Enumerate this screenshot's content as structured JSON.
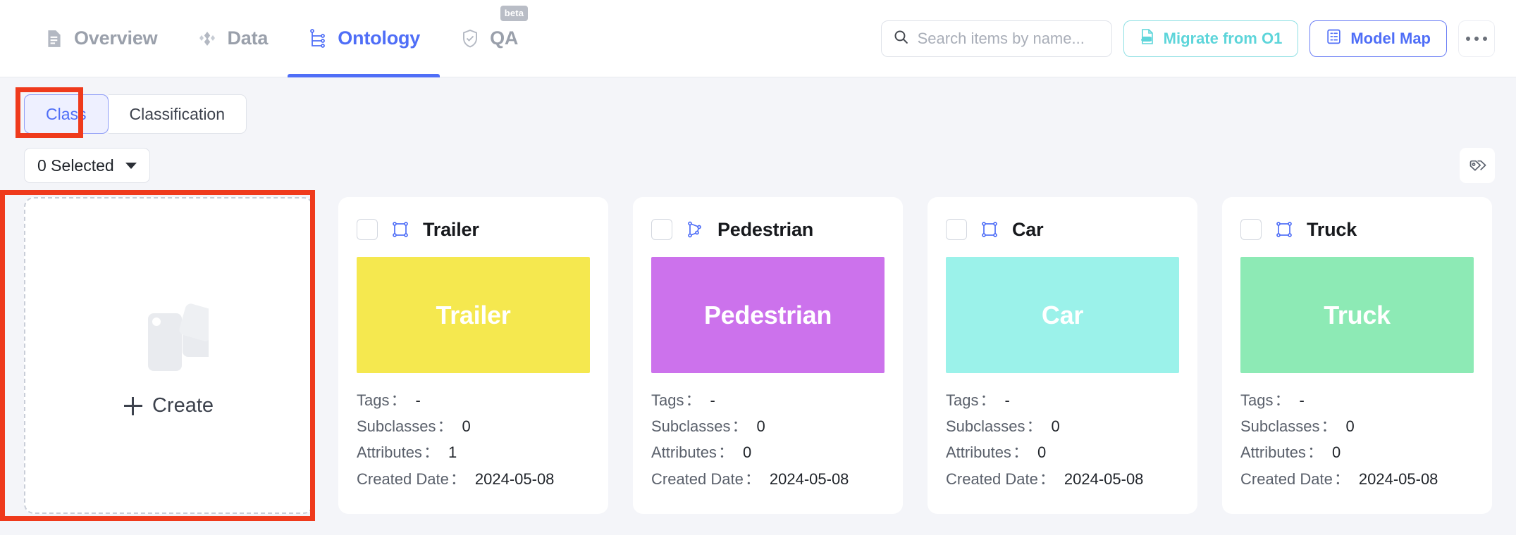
{
  "header": {
    "nav": [
      {
        "label": "Overview",
        "icon": "document-icon",
        "active": false,
        "badge": null
      },
      {
        "label": "Data",
        "icon": "diamond-icon",
        "active": false,
        "badge": null
      },
      {
        "label": "Ontology",
        "icon": "hierarchy-icon",
        "active": true,
        "badge": null
      },
      {
        "label": "QA",
        "icon": "shield-check-icon",
        "active": false,
        "badge": "beta"
      }
    ],
    "search": {
      "placeholder": "Search items by name...",
      "value": "",
      "icon": "search-icon"
    },
    "migrate_button": {
      "label": "Migrate from O1",
      "icon": "json-file-icon"
    },
    "model_map_button": {
      "label": "Model Map",
      "icon": "list-panel-icon"
    },
    "more_button": {
      "label": "",
      "icon": "more-horizontal-icon"
    }
  },
  "toolbar": {
    "segments": [
      {
        "label": "Class",
        "active": true
      },
      {
        "label": "Classification",
        "active": false
      }
    ],
    "selected_dropdown": {
      "label": "0 Selected",
      "icon": "chevron-down-icon"
    },
    "tag_button": {
      "icon": "tags-icon"
    }
  },
  "create_card": {
    "label": "Create",
    "plus_icon": "plus-icon",
    "illustration_icon": "blocks-icon"
  },
  "meta_labels": {
    "tags": "Tags",
    "subclasses": "Subclasses",
    "attributes": "Attributes",
    "created_date": "Created Date",
    "separator": "："
  },
  "cards": [
    {
      "name": "Trailer",
      "shape_icon": "rect-bbox-icon",
      "color": "#f5e84f",
      "checked": false,
      "tags": "-",
      "subclasses": "0",
      "attributes": "1",
      "created_date": "2024-05-08"
    },
    {
      "name": "Pedestrian",
      "shape_icon": "polygon-icon",
      "color": "#cc72ec",
      "checked": false,
      "tags": "-",
      "subclasses": "0",
      "attributes": "0",
      "created_date": "2024-05-08"
    },
    {
      "name": "Car",
      "shape_icon": "rect-bbox-icon",
      "color": "#9bf2ea",
      "checked": false,
      "tags": "-",
      "subclasses": "0",
      "attributes": "0",
      "created_date": "2024-05-08"
    },
    {
      "name": "Truck",
      "shape_icon": "rect-bbox-icon",
      "color": "#8deab5",
      "checked": false,
      "tags": "-",
      "subclasses": "0",
      "attributes": "0",
      "created_date": "2024-05-08"
    }
  ],
  "annotations": {
    "highlight_color": "#ef3a1c",
    "boxes": [
      "class-tab",
      "create-card"
    ]
  }
}
